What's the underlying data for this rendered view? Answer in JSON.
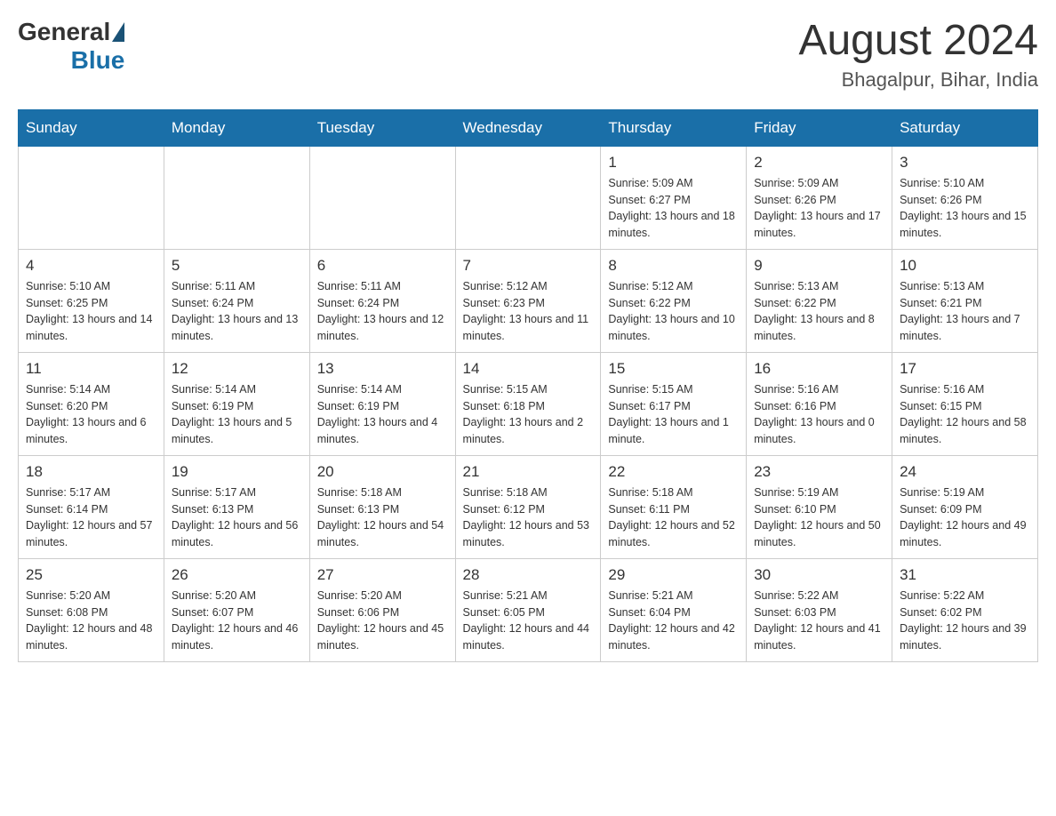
{
  "header": {
    "logo_general": "General",
    "logo_blue": "Blue",
    "title": "August 2024",
    "subtitle": "Bhagalpur, Bihar, India"
  },
  "weekdays": [
    "Sunday",
    "Monday",
    "Tuesday",
    "Wednesday",
    "Thursday",
    "Friday",
    "Saturday"
  ],
  "weeks": [
    [
      {
        "day": "",
        "sunrise": "",
        "sunset": "",
        "daylight": ""
      },
      {
        "day": "",
        "sunrise": "",
        "sunset": "",
        "daylight": ""
      },
      {
        "day": "",
        "sunrise": "",
        "sunset": "",
        "daylight": ""
      },
      {
        "day": "",
        "sunrise": "",
        "sunset": "",
        "daylight": ""
      },
      {
        "day": "1",
        "sunrise": "Sunrise: 5:09 AM",
        "sunset": "Sunset: 6:27 PM",
        "daylight": "Daylight: 13 hours and 18 minutes."
      },
      {
        "day": "2",
        "sunrise": "Sunrise: 5:09 AM",
        "sunset": "Sunset: 6:26 PM",
        "daylight": "Daylight: 13 hours and 17 minutes."
      },
      {
        "day": "3",
        "sunrise": "Sunrise: 5:10 AM",
        "sunset": "Sunset: 6:26 PM",
        "daylight": "Daylight: 13 hours and 15 minutes."
      }
    ],
    [
      {
        "day": "4",
        "sunrise": "Sunrise: 5:10 AM",
        "sunset": "Sunset: 6:25 PM",
        "daylight": "Daylight: 13 hours and 14 minutes."
      },
      {
        "day": "5",
        "sunrise": "Sunrise: 5:11 AM",
        "sunset": "Sunset: 6:24 PM",
        "daylight": "Daylight: 13 hours and 13 minutes."
      },
      {
        "day": "6",
        "sunrise": "Sunrise: 5:11 AM",
        "sunset": "Sunset: 6:24 PM",
        "daylight": "Daylight: 13 hours and 12 minutes."
      },
      {
        "day": "7",
        "sunrise": "Sunrise: 5:12 AM",
        "sunset": "Sunset: 6:23 PM",
        "daylight": "Daylight: 13 hours and 11 minutes."
      },
      {
        "day": "8",
        "sunrise": "Sunrise: 5:12 AM",
        "sunset": "Sunset: 6:22 PM",
        "daylight": "Daylight: 13 hours and 10 minutes."
      },
      {
        "day": "9",
        "sunrise": "Sunrise: 5:13 AM",
        "sunset": "Sunset: 6:22 PM",
        "daylight": "Daylight: 13 hours and 8 minutes."
      },
      {
        "day": "10",
        "sunrise": "Sunrise: 5:13 AM",
        "sunset": "Sunset: 6:21 PM",
        "daylight": "Daylight: 13 hours and 7 minutes."
      }
    ],
    [
      {
        "day": "11",
        "sunrise": "Sunrise: 5:14 AM",
        "sunset": "Sunset: 6:20 PM",
        "daylight": "Daylight: 13 hours and 6 minutes."
      },
      {
        "day": "12",
        "sunrise": "Sunrise: 5:14 AM",
        "sunset": "Sunset: 6:19 PM",
        "daylight": "Daylight: 13 hours and 5 minutes."
      },
      {
        "day": "13",
        "sunrise": "Sunrise: 5:14 AM",
        "sunset": "Sunset: 6:19 PM",
        "daylight": "Daylight: 13 hours and 4 minutes."
      },
      {
        "day": "14",
        "sunrise": "Sunrise: 5:15 AM",
        "sunset": "Sunset: 6:18 PM",
        "daylight": "Daylight: 13 hours and 2 minutes."
      },
      {
        "day": "15",
        "sunrise": "Sunrise: 5:15 AM",
        "sunset": "Sunset: 6:17 PM",
        "daylight": "Daylight: 13 hours and 1 minute."
      },
      {
        "day": "16",
        "sunrise": "Sunrise: 5:16 AM",
        "sunset": "Sunset: 6:16 PM",
        "daylight": "Daylight: 13 hours and 0 minutes."
      },
      {
        "day": "17",
        "sunrise": "Sunrise: 5:16 AM",
        "sunset": "Sunset: 6:15 PM",
        "daylight": "Daylight: 12 hours and 58 minutes."
      }
    ],
    [
      {
        "day": "18",
        "sunrise": "Sunrise: 5:17 AM",
        "sunset": "Sunset: 6:14 PM",
        "daylight": "Daylight: 12 hours and 57 minutes."
      },
      {
        "day": "19",
        "sunrise": "Sunrise: 5:17 AM",
        "sunset": "Sunset: 6:13 PM",
        "daylight": "Daylight: 12 hours and 56 minutes."
      },
      {
        "day": "20",
        "sunrise": "Sunrise: 5:18 AM",
        "sunset": "Sunset: 6:13 PM",
        "daylight": "Daylight: 12 hours and 54 minutes."
      },
      {
        "day": "21",
        "sunrise": "Sunrise: 5:18 AM",
        "sunset": "Sunset: 6:12 PM",
        "daylight": "Daylight: 12 hours and 53 minutes."
      },
      {
        "day": "22",
        "sunrise": "Sunrise: 5:18 AM",
        "sunset": "Sunset: 6:11 PM",
        "daylight": "Daylight: 12 hours and 52 minutes."
      },
      {
        "day": "23",
        "sunrise": "Sunrise: 5:19 AM",
        "sunset": "Sunset: 6:10 PM",
        "daylight": "Daylight: 12 hours and 50 minutes."
      },
      {
        "day": "24",
        "sunrise": "Sunrise: 5:19 AM",
        "sunset": "Sunset: 6:09 PM",
        "daylight": "Daylight: 12 hours and 49 minutes."
      }
    ],
    [
      {
        "day": "25",
        "sunrise": "Sunrise: 5:20 AM",
        "sunset": "Sunset: 6:08 PM",
        "daylight": "Daylight: 12 hours and 48 minutes."
      },
      {
        "day": "26",
        "sunrise": "Sunrise: 5:20 AM",
        "sunset": "Sunset: 6:07 PM",
        "daylight": "Daylight: 12 hours and 46 minutes."
      },
      {
        "day": "27",
        "sunrise": "Sunrise: 5:20 AM",
        "sunset": "Sunset: 6:06 PM",
        "daylight": "Daylight: 12 hours and 45 minutes."
      },
      {
        "day": "28",
        "sunrise": "Sunrise: 5:21 AM",
        "sunset": "Sunset: 6:05 PM",
        "daylight": "Daylight: 12 hours and 44 minutes."
      },
      {
        "day": "29",
        "sunrise": "Sunrise: 5:21 AM",
        "sunset": "Sunset: 6:04 PM",
        "daylight": "Daylight: 12 hours and 42 minutes."
      },
      {
        "day": "30",
        "sunrise": "Sunrise: 5:22 AM",
        "sunset": "Sunset: 6:03 PM",
        "daylight": "Daylight: 12 hours and 41 minutes."
      },
      {
        "day": "31",
        "sunrise": "Sunrise: 5:22 AM",
        "sunset": "Sunset: 6:02 PM",
        "daylight": "Daylight: 12 hours and 39 minutes."
      }
    ]
  ]
}
